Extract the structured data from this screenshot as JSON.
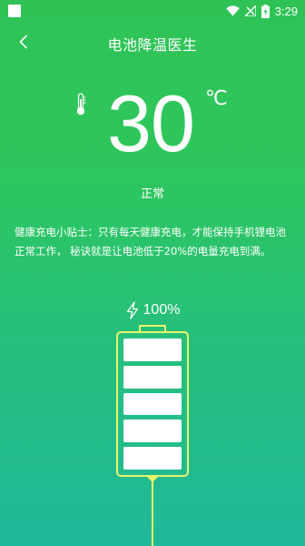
{
  "status_bar": {
    "time": "3:29",
    "icons": [
      "wifi-icon",
      "signal-icon",
      "battery-status-icon"
    ]
  },
  "app_bar": {
    "title": "电池降温医生",
    "back_icon": "back-arrow-icon"
  },
  "temperature": {
    "value": "30",
    "unit": "℃",
    "status": "正常",
    "icon": "thermometer-icon"
  },
  "tip": {
    "text": "健康充电小贴士：只有每天健康充电，才能保持手机锂电池正常工作， 秘诀就是让电池低于20%的电量充电到满。"
  },
  "charge": {
    "icon": "lightning-icon",
    "percent_label": "100%",
    "level": 1.0
  },
  "colors": {
    "accent_yellow": "#e9f56a",
    "bg_top": "#2fc356",
    "bg_bottom": "#20b89a"
  }
}
